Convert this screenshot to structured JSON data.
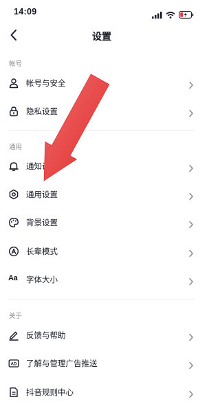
{
  "status_bar": {
    "time": "14:09"
  },
  "header": {
    "title": "设置"
  },
  "sections": {
    "account": {
      "title": "帐号",
      "items": [
        {
          "label": "帐号与安全",
          "icon": "person-icon"
        },
        {
          "label": "隐私设置",
          "icon": "lock-icon"
        }
      ]
    },
    "general": {
      "title": "通用",
      "items": [
        {
          "label": "通知设置",
          "icon": "bell-icon"
        },
        {
          "label": "通用设置",
          "icon": "gear-icon"
        },
        {
          "label": "背景设置",
          "icon": "palette-icon"
        },
        {
          "label": "长辈模式",
          "icon": "elder-mode-icon"
        },
        {
          "label": "字体大小",
          "icon": "font-size-icon",
          "icon_text": "Aa"
        }
      ]
    },
    "about": {
      "title": "关于",
      "items": [
        {
          "label": "反馈与帮助",
          "icon": "pen-icon"
        },
        {
          "label": "了解与管理广告推送",
          "icon": "ad-icon",
          "icon_text": "AD"
        },
        {
          "label": "抖音规则中心",
          "icon": "document-icon"
        }
      ]
    }
  },
  "annotation": {
    "arrow_color": "#e63b3b"
  }
}
